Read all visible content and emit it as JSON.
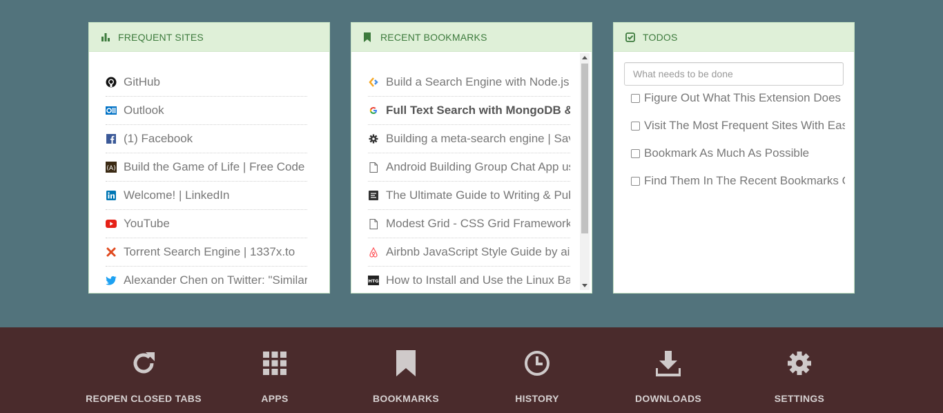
{
  "colors": {
    "background": "#52737c",
    "panel_header_bg": "#dff0d8",
    "panel_header_text": "#3c7a3c",
    "footer_bg": "#4a2b2c",
    "footer_text": "#d7d2d2"
  },
  "frequent_sites": {
    "title": "FREQUENT SITES",
    "icon": "bar-chart-icon",
    "items": [
      {
        "label": "GitHub",
        "icon": "github-icon"
      },
      {
        "label": "Outlook",
        "icon": "outlook-icon"
      },
      {
        "label": "(1) Facebook",
        "icon": "facebook-icon"
      },
      {
        "label": "Build the Game of Life | Free Code Camp",
        "icon": "freecodecamp-icon"
      },
      {
        "label": "Welcome! | LinkedIn",
        "icon": "linkedin-icon"
      },
      {
        "label": "YouTube",
        "icon": "youtube-icon"
      },
      {
        "label": "Torrent Search Engine | 1337x.to",
        "icon": "1337x-icon"
      },
      {
        "label": "Alexander Chen on Twitter: \"Similar",
        "icon": "twitter-icon"
      }
    ]
  },
  "recent_bookmarks": {
    "title": "RECENT BOOKMARKS",
    "icon": "bookmark-icon",
    "items": [
      {
        "label": "Build a Search Engine with Node.js",
        "icon": "codementor-icon",
        "bold": false
      },
      {
        "label": "Full Text Search with MongoDB & Node.js",
        "icon": "google-icon",
        "bold": true
      },
      {
        "label": "Building a meta-search engine | Sav",
        "icon": "gear-icon",
        "bold": false
      },
      {
        "label": "Android Building Group Chat App us",
        "icon": "page-icon",
        "bold": false
      },
      {
        "label": "The Ultimate Guide to Writing & Pub",
        "icon": "doc-dark-icon",
        "bold": false
      },
      {
        "label": "Modest Grid - CSS Grid Framework",
        "icon": "page-icon",
        "bold": false
      },
      {
        "label": "Airbnb JavaScript Style Guide by air",
        "icon": "airbnb-icon",
        "bold": false
      },
      {
        "label": "How to Install and Use the Linux Ba",
        "icon": "htg-icon",
        "bold": false
      }
    ]
  },
  "todos": {
    "title": "TODOS",
    "icon": "check-square-icon",
    "input_placeholder": "What needs to be done",
    "items": [
      {
        "label": "Figure Out What This Extension Does",
        "checked": false
      },
      {
        "label": "Visit The Most Frequent Sites With Ease",
        "checked": false
      },
      {
        "label": "Bookmark As Much As Possible",
        "checked": false
      },
      {
        "label": "Find Them In The Recent Bookmarks Component",
        "checked": false
      }
    ]
  },
  "footer": {
    "buttons": [
      {
        "label": "REOPEN CLOSED TABS",
        "icon": "refresh-icon"
      },
      {
        "label": "APPS",
        "icon": "apps-grid-icon"
      },
      {
        "label": "BOOKMARKS",
        "icon": "bookmark-icon"
      },
      {
        "label": "HISTORY",
        "icon": "clock-icon"
      },
      {
        "label": "DOWNLOADS",
        "icon": "download-icon"
      },
      {
        "label": "SETTINGS",
        "icon": "gear-icon"
      }
    ]
  }
}
